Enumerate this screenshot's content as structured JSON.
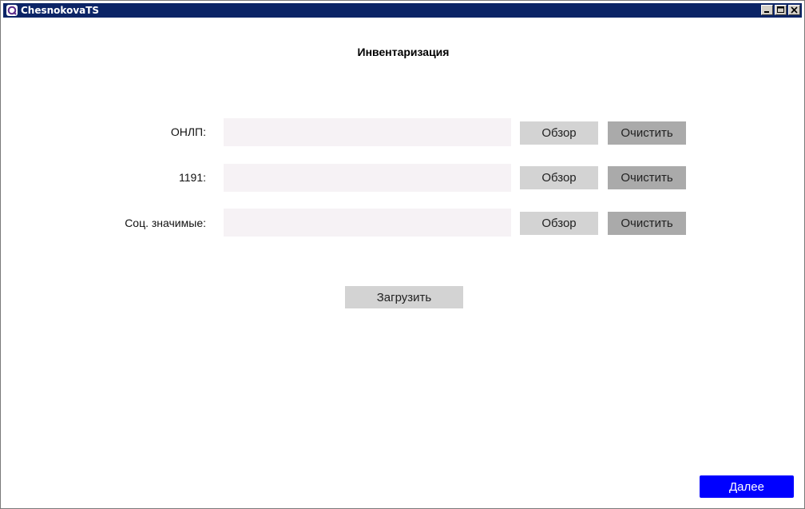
{
  "window": {
    "title": "ChesnokovaTS"
  },
  "page": {
    "title": "Инвентаризация"
  },
  "rows": [
    {
      "label": "ОНЛП:",
      "value": "",
      "browse_label": "Обзор",
      "clear_label": "Очистить"
    },
    {
      "label": "1191:",
      "value": "",
      "browse_label": "Обзор",
      "clear_label": "Очистить"
    },
    {
      "label": "Соц. значимые:",
      "value": "",
      "browse_label": "Обзор",
      "clear_label": "Очистить"
    }
  ],
  "actions": {
    "load_label": "Загрузить",
    "next_label": "Далее"
  },
  "colors": {
    "titlebar": "#0b2466",
    "field_bg": "#f6f2f5",
    "browse_bg": "#d3d3d3",
    "clear_bg": "#aaaaaa",
    "primary": "#0000ff"
  },
  "icons": {
    "app": "app-logo-icon",
    "minimize": "minimize-icon",
    "maximize": "maximize-icon",
    "close": "close-icon"
  }
}
